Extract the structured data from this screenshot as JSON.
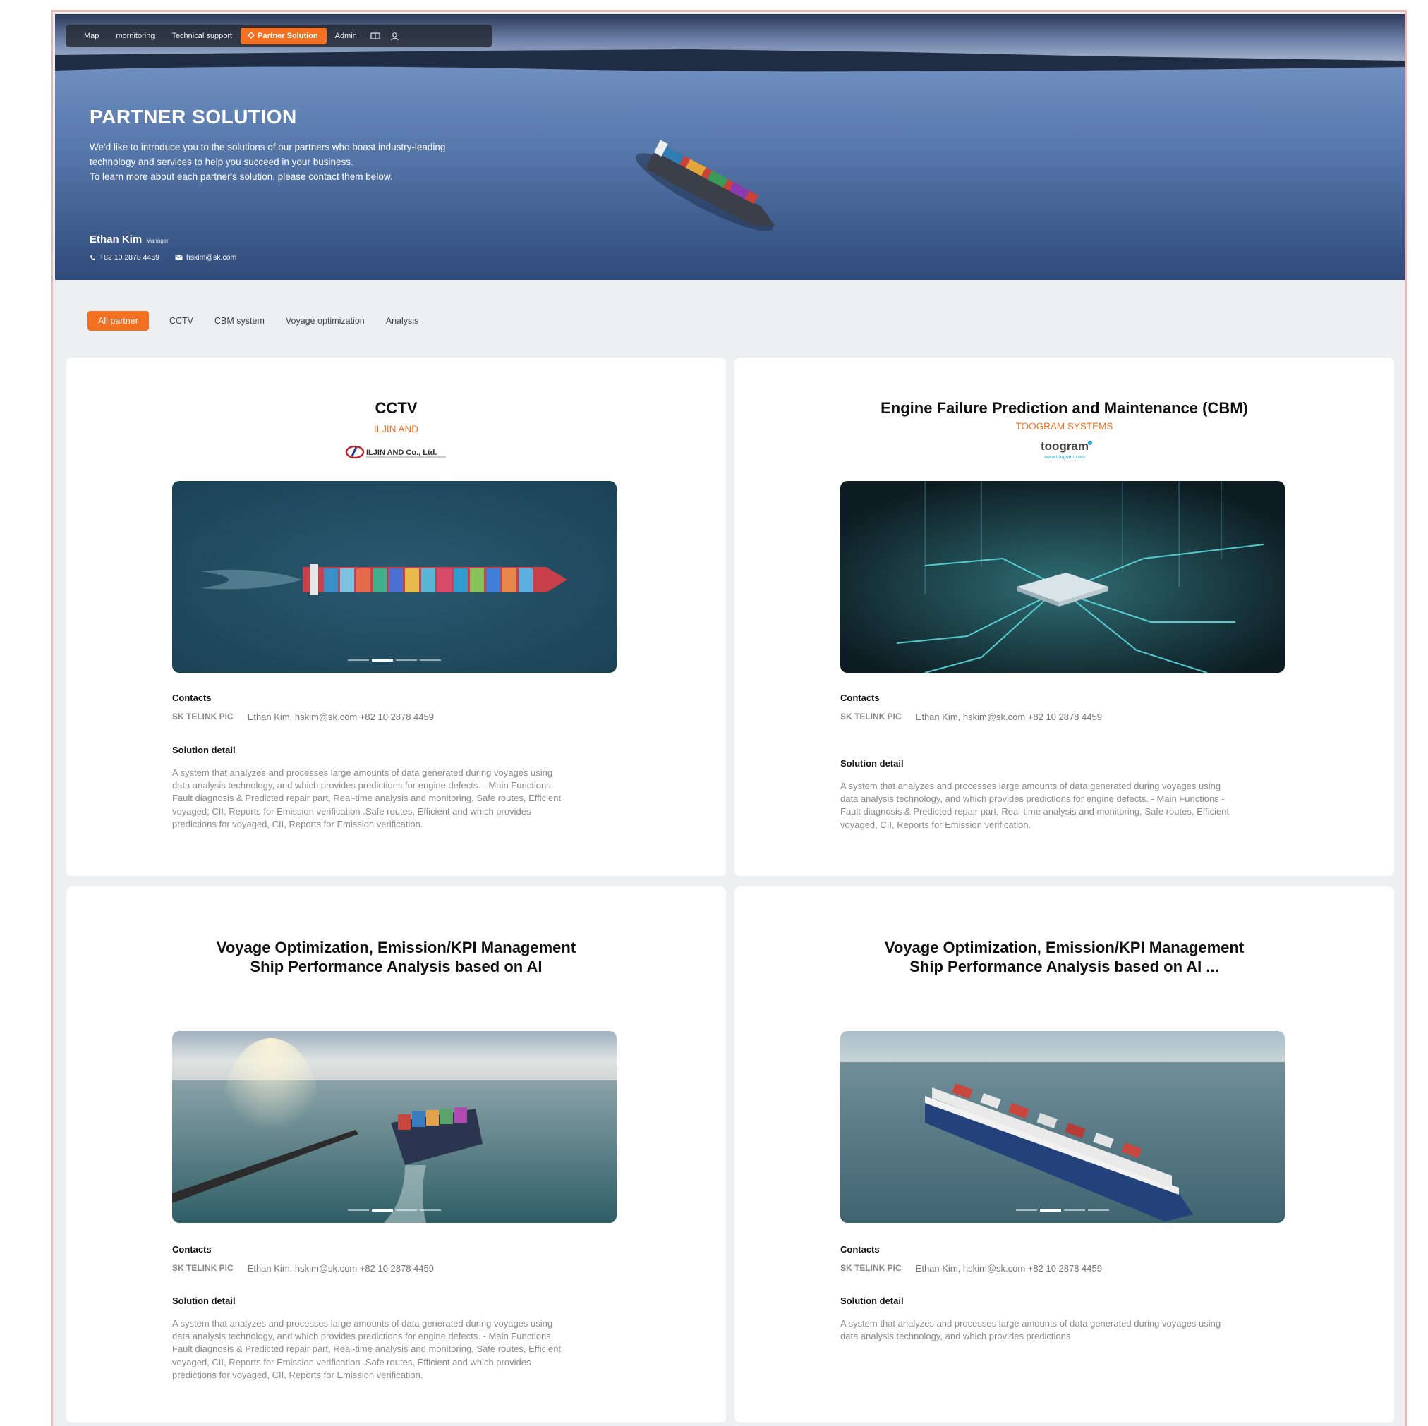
{
  "nav": {
    "items": [
      {
        "label": "Map"
      },
      {
        "label": "mornitoring"
      },
      {
        "label": "Technical support"
      },
      {
        "label": "Partner Solution",
        "active": true
      },
      {
        "label": "Admin"
      }
    ],
    "icons": [
      "book-icon",
      "user-icon"
    ]
  },
  "hero": {
    "title": "PARTNER SOLUTION",
    "desc_lines": [
      "We'd like to introduce you to the solutions of our partners who boast industry-leading",
      "technology and services to help you succeed in your business.",
      "To learn more about each partner's solution, please contact them below."
    ],
    "person": {
      "name": "Ethan Kim",
      "role": "Manager"
    },
    "phone": "+82 10 2878 4459",
    "email": "hskim@sk.com"
  },
  "tabs": [
    {
      "label": "All partner",
      "active": true
    },
    {
      "label": "CCTV"
    },
    {
      "label": "CBM system"
    },
    {
      "label": "Voyage optimization"
    },
    {
      "label": "Analysis"
    }
  ],
  "accent_color": "#f36f21",
  "cards": [
    {
      "title_lines": [
        "CCTV"
      ],
      "partner": "ILJIN AND",
      "logo_text": "ILJIN AND Co., Ltd.",
      "contacts_label": "Contacts",
      "pic_label": "SK TELINK PIC",
      "contact_info": "Ethan Kim, hskim@sk.com +82 10 2878 4459",
      "detail_label": "Solution detail",
      "detail_lines": [
        "A system that analyzes and processes large amounts of data generated during voyages using",
        "data analysis technology, and which provides predictions for engine defects. - Main Functions",
        "Fault diagnosis & Predicted repair part, Real-time analysis and monitoring, Safe routes, Efficient",
        "voyaged, CII, Reports for Emission verification .Safe routes, Efficient and which provides",
        "predictions for voyaged, CII, Reports for Emission verification."
      ],
      "slide_count": 4,
      "active_slide": 2
    },
    {
      "title_lines": [
        "Engine Failure Prediction and Maintenance (CBM)"
      ],
      "partner": "TOOGRAM SYSTEMS",
      "logo_text": "toogram",
      "logo_url_text": "www.toogram.com",
      "contacts_label": "Contacts",
      "pic_label": "SK TELINK PIC",
      "contact_info": "Ethan Kim, hskim@sk.com +82 10 2878 4459",
      "detail_label": "Solution detail",
      "detail_lines": [
        "A system that analyzes and processes large amounts of data generated during voyages using",
        "data analysis technology, and which provides predictions for engine defects. - Main Functions -",
        "Fault diagnosis & Predicted repair part, Real-time analysis and monitoring, Safe routes, Efficient",
        "voyaged, CII, Reports for Emission verification."
      ]
    },
    {
      "title_lines": [
        "Voyage Optimization, Emission/KPI Management",
        "Ship Performance Analysis based on AI"
      ],
      "contacts_label": "Contacts",
      "pic_label": "SK TELINK PIC",
      "contact_info": "Ethan Kim, hskim@sk.com +82 10 2878 4459",
      "detail_label": "Solution detail",
      "detail_lines": [
        "A system that analyzes and processes large amounts of data generated during voyages using",
        "data analysis technology, and which provides predictions for engine defects. - Main Functions",
        "Fault diagnosis & Predicted repair part, Real-time analysis and monitoring, Safe routes, Efficient",
        "voyaged, CII, Reports for Emission verification .Safe routes, Efficient and which provides",
        "predictions for voyaged, CII, Reports for Emission verification."
      ],
      "slide_count": 4,
      "active_slide": 2
    },
    {
      "title_lines": [
        "Voyage Optimization, Emission/KPI Management",
        "Ship Performance Analysis based on AI ..."
      ],
      "contacts_label": "Contacts",
      "pic_label": "SK TELINK PIC",
      "contact_info": "Ethan Kim, hskim@sk.com +82 10 2878 4459",
      "detail_label": "Solution detail",
      "detail_lines": [
        "A system that analyzes and processes large amounts of data generated during voyages using",
        "data analysis technology, and which provides predictions."
      ],
      "slide_count": 4,
      "active_slide": 2
    }
  ]
}
